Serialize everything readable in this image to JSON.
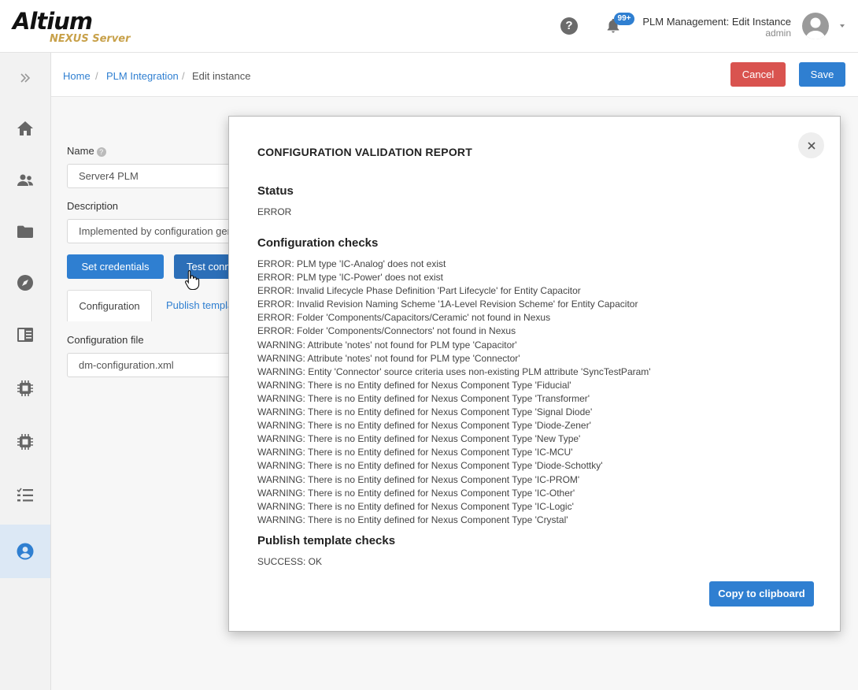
{
  "header": {
    "logo_main": "Altium",
    "logo_sub": "NEXUS Server",
    "help_symbol": "?",
    "notification_count": "99+",
    "page_title": "PLM Management: Edit Instance",
    "user_name": "admin"
  },
  "sidebar": {
    "items": [
      {
        "icon": "expand-chevrons-icon"
      },
      {
        "icon": "home-icon"
      },
      {
        "icon": "users-icon"
      },
      {
        "icon": "folder-icon"
      },
      {
        "icon": "compass-icon"
      },
      {
        "icon": "book-icon"
      },
      {
        "icon": "chip-icon"
      },
      {
        "icon": "chip-icon"
      },
      {
        "icon": "checklist-icon"
      },
      {
        "icon": "user-circle-icon",
        "active": true
      }
    ]
  },
  "breadcrumb": {
    "home": "Home",
    "sep": "/",
    "plm": "PLM Integration",
    "current": "Edit instance"
  },
  "toolbar": {
    "cancel_label": "Cancel",
    "save_label": "Save"
  },
  "form": {
    "name_label": "Name",
    "name_help": "?",
    "name_value": "Server4 PLM",
    "description_label": "Description",
    "description_value": "Implemented by configuration ger",
    "set_credentials_label": "Set credentials",
    "test_connection_label": "Test conn",
    "tabs": {
      "configuration": "Configuration",
      "publish": "Publish templa"
    },
    "config_file_label": "Configuration file",
    "config_file_value": "dm-configuration.xml"
  },
  "modal": {
    "title": "CONFIGURATION VALIDATION REPORT",
    "close_symbol": "×",
    "status_heading": "Status",
    "status_value": "ERROR",
    "config_checks_heading": "Configuration checks",
    "config_checks": [
      "ERROR: PLM type 'IC-Analog' does not exist",
      "ERROR: PLM type 'IC-Power' does not exist",
      "ERROR: Invalid Lifecycle Phase Definition 'Part Lifecycle' for Entity Capacitor",
      "ERROR: Invalid Revision Naming Scheme '1A-Level Revision Scheme' for Entity Capacitor",
      "ERROR: Folder 'Components/Capacitors/Ceramic' not found in Nexus",
      "ERROR: Folder 'Components/Connectors' not found in Nexus",
      "WARNING: Attribute 'notes' not found for PLM type 'Capacitor'",
      "WARNING: Attribute 'notes' not found for PLM type 'Connector'",
      "WARNING: Entity 'Connector' source criteria uses non-existing PLM attribute 'SyncTestParam'",
      "WARNING: There is no Entity defined for Nexus Component Type 'Fiducial'",
      "WARNING: There is no Entity defined for Nexus Component Type 'Transformer'",
      "WARNING: There is no Entity defined for Nexus Component Type 'Signal Diode'",
      "WARNING: There is no Entity defined for Nexus Component Type 'Diode-Zener'",
      "WARNING: There is no Entity defined for Nexus Component Type 'New Type'",
      "WARNING: There is no Entity defined for Nexus Component Type 'IC-MCU'",
      "WARNING: There is no Entity defined for Nexus Component Type 'Diode-Schottky'",
      "WARNING: There is no Entity defined for Nexus Component Type 'IC-PROM'",
      "WARNING: There is no Entity defined for Nexus Component Type 'IC-Other'",
      "WARNING: There is no Entity defined for Nexus Component Type 'IC-Logic'",
      "WARNING: There is no Entity defined for Nexus Component Type 'Crystal'"
    ],
    "publish_checks_heading": "Publish template checks",
    "publish_result": "SUCCESS: OK",
    "copy_label": "Copy to clipboard"
  },
  "colors": {
    "accent": "#2f7fd1",
    "danger": "#d9534f",
    "sidebar_active": "#dce8f5",
    "logo_gold": "#c8a14a"
  }
}
